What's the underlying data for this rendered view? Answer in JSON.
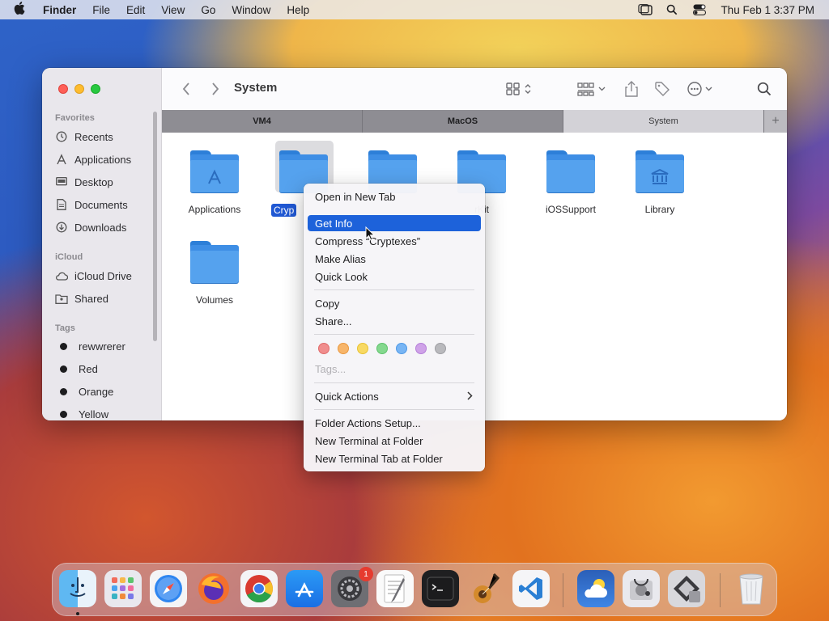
{
  "menubar": {
    "app": "Finder",
    "items": [
      "File",
      "Edit",
      "View",
      "Go",
      "Window",
      "Help"
    ],
    "datetime": "Thu Feb 1  3:37 PM"
  },
  "window": {
    "title": "System",
    "tabs": [
      "VM4",
      "MacOS",
      "System"
    ],
    "sidebar": {
      "favorites_header": "Favorites",
      "favorites": [
        "Recents",
        "Applications",
        "Desktop",
        "Documents",
        "Downloads"
      ],
      "icloud_header": "iCloud",
      "icloud": [
        "iCloud Drive",
        "Shared"
      ],
      "tags_header": "Tags",
      "tags": [
        "rewwrerer",
        "Red",
        "Orange",
        "Yellow"
      ]
    },
    "items": [
      {
        "name": "Applications",
        "emblem": "A"
      },
      {
        "name": "Cryp",
        "emblem": ""
      },
      {
        "name": "",
        "emblem": ""
      },
      {
        "name": "rKit",
        "emblem": ""
      },
      {
        "name": "iOSSupport",
        "emblem": ""
      },
      {
        "name": "Library",
        "emblem": "library"
      },
      {
        "name": "Volumes",
        "emblem": ""
      }
    ]
  },
  "context_menu": {
    "items": [
      "Open in New Tab",
      "Get Info",
      "Compress “Cryptexes”",
      "Make Alias",
      "Quick Look",
      "Copy",
      "Share...",
      "Tags...",
      "Quick Actions",
      "Folder Actions Setup...",
      "New Terminal at Folder",
      "New Terminal Tab at Folder"
    ],
    "tag_colors": [
      "#f16b6b",
      "#f6a64a",
      "#f7d34c",
      "#6cd07a",
      "#5aa6f2",
      "#c38ae3",
      "#a9a9ad"
    ]
  },
  "dock": {
    "badge_count": "1",
    "apps": [
      "finder",
      "launchpad",
      "safari",
      "firefox",
      "chrome",
      "app-store",
      "system-settings",
      "textedit",
      "terminal",
      "garageband",
      "vscode",
      "weather",
      "utility",
      "boot-camp",
      "trash"
    ]
  }
}
